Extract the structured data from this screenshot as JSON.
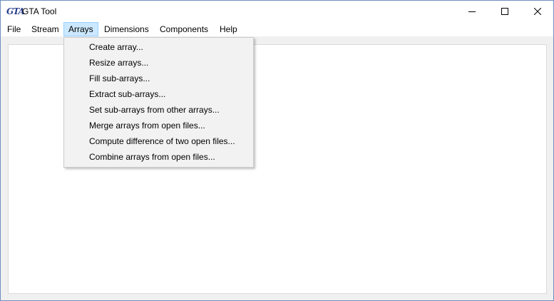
{
  "window": {
    "title": "GTA Tool",
    "icon_text": "GTA"
  },
  "menu": {
    "items": [
      {
        "label": "File"
      },
      {
        "label": "Stream"
      },
      {
        "label": "Arrays"
      },
      {
        "label": "Dimensions"
      },
      {
        "label": "Components"
      },
      {
        "label": "Help"
      }
    ],
    "active": "Arrays"
  },
  "arrays_menu": {
    "items": [
      {
        "label": "Create array..."
      },
      {
        "label": "Resize arrays..."
      },
      {
        "label": "Fill sub-arrays..."
      },
      {
        "label": "Extract sub-arrays..."
      },
      {
        "label": "Set sub-arrays from other arrays..."
      },
      {
        "label": "Merge arrays from open files..."
      },
      {
        "label": "Compute difference of two open files..."
      },
      {
        "label": "Combine arrays from open files..."
      }
    ]
  },
  "colors": {
    "menu_highlight": "#cce8ff",
    "menu_highlight_border": "#99d1ff",
    "icon_blue": "#2a3f8f"
  }
}
